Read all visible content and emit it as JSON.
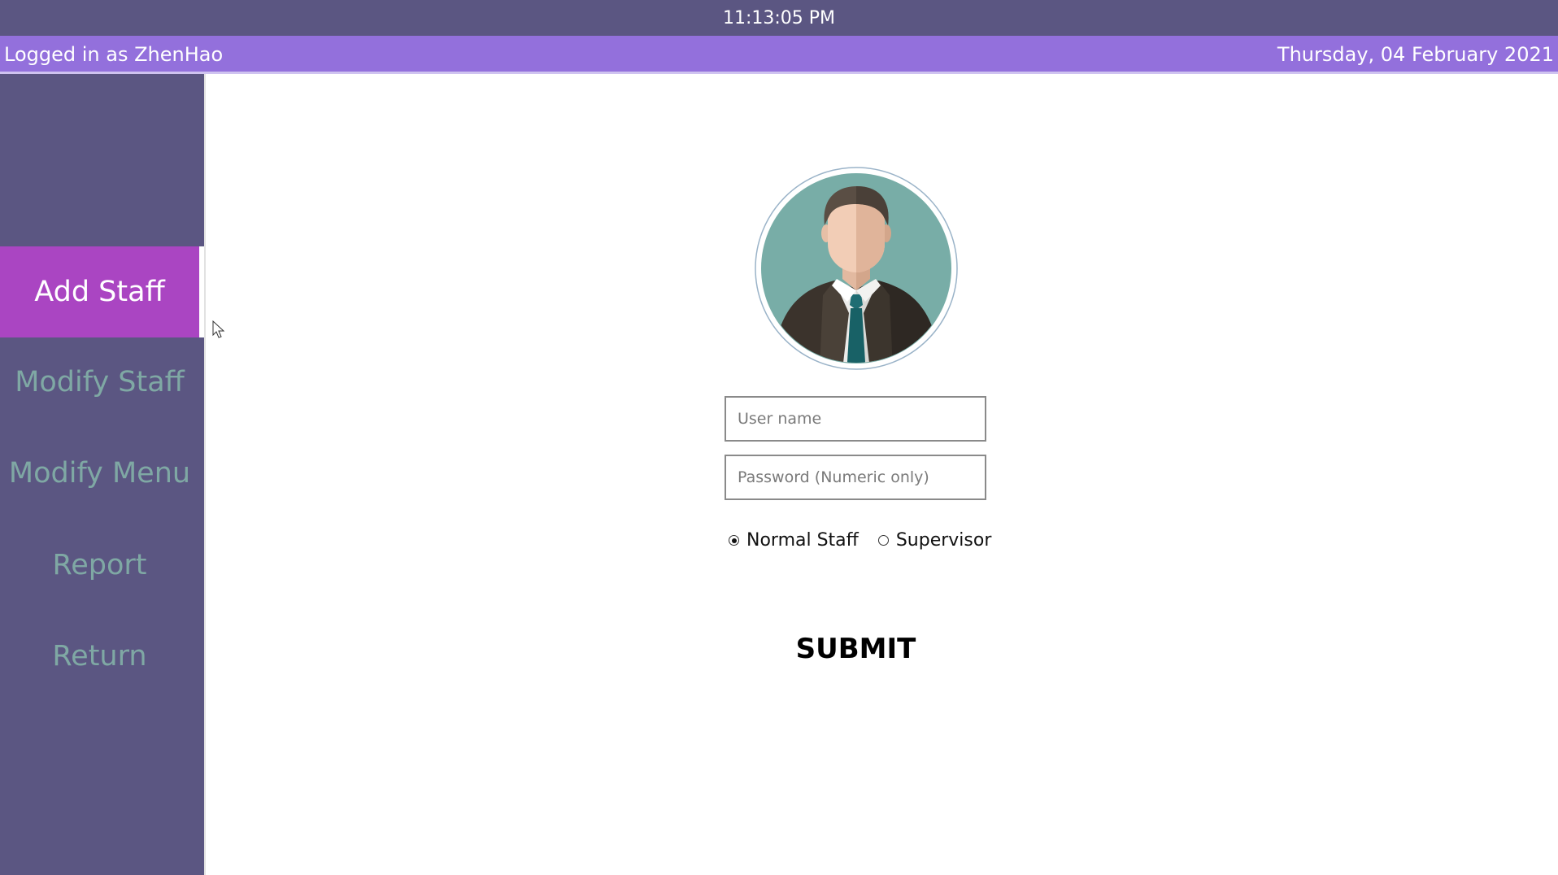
{
  "header": {
    "clock": "11:13:05 PM",
    "logged_in": "Logged in as ZhenHao",
    "date": "Thursday, 04 February 2021"
  },
  "sidebar": {
    "items": [
      {
        "label": "Add Staff",
        "active": true
      },
      {
        "label": "Modify Staff",
        "active": false
      },
      {
        "label": "Modify Menu",
        "active": false
      },
      {
        "label": "Report",
        "active": false
      },
      {
        "label": "Return",
        "active": false
      }
    ]
  },
  "form": {
    "username_placeholder": "User name",
    "password_placeholder": "Password (Numeric only)",
    "username_value": "",
    "password_value": "",
    "roles": [
      {
        "label": "Normal Staff",
        "selected": true
      },
      {
        "label": "Supervisor",
        "selected": false
      }
    ],
    "submit_label": "SUBMIT"
  },
  "icons": {
    "avatar": "staff-avatar-icon",
    "cursor": "mouse-pointer-icon"
  },
  "colors": {
    "top_bar": "#5b5682",
    "status_bar": "#9370dc",
    "sidebar": "#5b5682",
    "active_item": "#aa45c2",
    "inactive_text": "#7fa8a4"
  }
}
